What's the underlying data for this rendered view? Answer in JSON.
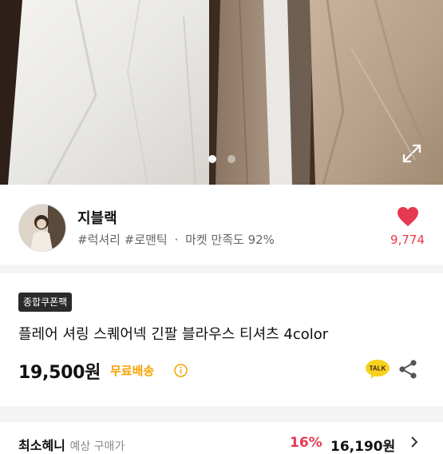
{
  "hero": {
    "dots": [
      true,
      false
    ]
  },
  "seller": {
    "name": "지블랙",
    "tags": [
      "#럭셔리",
      "#로맨틱"
    ],
    "market_satisfaction": "마켓 만족도 92%",
    "separator": "·",
    "likes": "9,774"
  },
  "product": {
    "badge": "종합쿠폰팩",
    "title": "플레어 셔링 스퀘어넥 긴팔 블라우스 티셔츠 4color",
    "price": "19,500원",
    "shipping": "무료배송",
    "talk_label": "TALK"
  },
  "lowest": {
    "label": "최소혜니",
    "sub": "예상 구매가",
    "discount": "16%",
    "price": "16,190원"
  },
  "colors": {
    "accent_red": "#e63950",
    "shipping_yellow": "#f5a200",
    "badge_dark": "#2b2b2b",
    "talk_yellow": "#f7d21e"
  }
}
